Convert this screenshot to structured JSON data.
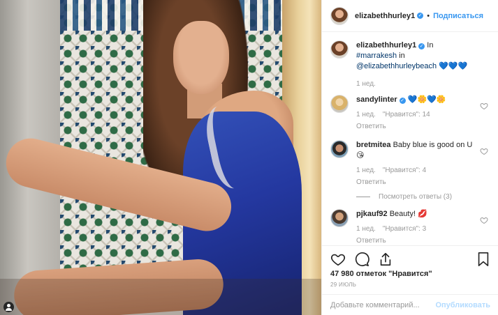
{
  "post": {
    "author": "elizabethhurley1",
    "follow_label": "Подписаться",
    "dot": "•",
    "caption": {
      "prefix": "In",
      "hashtag": "#marrakesh",
      "middle": "in",
      "mention": "@elizabethhurleybeach",
      "emoji": "💙💙💙",
      "time": "1 нед."
    }
  },
  "comments": [
    {
      "user": "sandylinter",
      "verified": true,
      "text": "💙🌼💙🌼",
      "time": "1 нед.",
      "likes": "\"Нравится\": 14",
      "reply": "Ответить"
    },
    {
      "user": "bretmitea",
      "verified": false,
      "text": "Baby blue is good on U 😘",
      "time": "1 нед.",
      "likes": "\"Нравится\": 4",
      "reply": "Ответить",
      "view_replies": "Посмотреть ответы (3)"
    },
    {
      "user": "pjkauf92",
      "verified": false,
      "text": "Beauty! 💋",
      "time": "1 нед.",
      "likes": "\"Нравится\": 3",
      "reply": "Ответить"
    }
  ],
  "likes_label": "47 980 отметок \"Нравится\"",
  "date_label": "29 ИЮЛЬ",
  "add_comment": {
    "placeholder": "Добавьте комментарий...",
    "post_label": "Опубликовать"
  },
  "icons": [
    "heart-icon",
    "comment-icon",
    "share-icon",
    "bookmark-icon",
    "user-tag-icon"
  ],
  "colors": {
    "accent": "#3897f0",
    "muted": "#999999",
    "text": "#262626",
    "post_disabled": "#b3dbff"
  }
}
